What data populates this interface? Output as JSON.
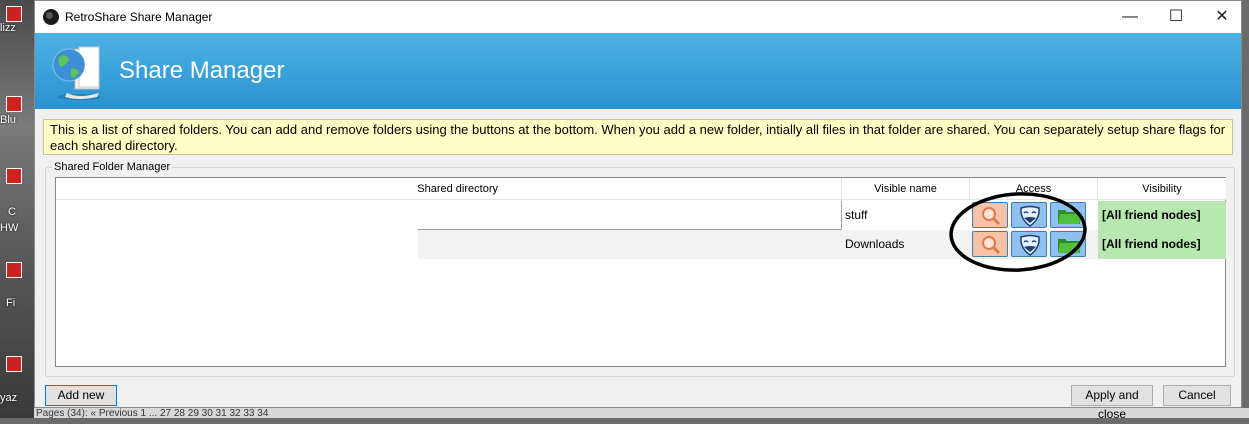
{
  "window": {
    "title": "RetroShare Share Manager",
    "controls": {
      "minimize": "—",
      "maximize": "☐",
      "close": "✕"
    }
  },
  "banner": {
    "title": "Share Manager",
    "icon": "shared-folder-globe-icon"
  },
  "info_text": "This is a list of shared folders. You can add and remove folders using the buttons at the bottom. When you add a new folder, intially all files in that folder are shared. You can separately setup share flags for each shared directory.",
  "group": {
    "legend": "Shared Folder Manager",
    "columns": {
      "shared_directory": "Shared directory",
      "visible_name": "Visible name",
      "access": "Access",
      "visibility": "Visibility"
    },
    "rows": [
      {
        "visible_name": "stuff",
        "access_icons": [
          "search-icon",
          "anonymous-mask-icon",
          "folder-icon"
        ],
        "visibility": "[All friend nodes]"
      },
      {
        "visible_name": "Downloads",
        "access_icons": [
          "search-icon",
          "anonymous-mask-icon",
          "folder-icon"
        ],
        "visibility": "[All friend nodes]"
      }
    ]
  },
  "buttons": {
    "add_new": "Add new",
    "apply_and_close": "Apply and close",
    "cancel": "Cancel"
  },
  "desktop": {
    "labels": [
      "lizz",
      "Blu",
      "C",
      "HW",
      "Fi",
      "yaz"
    ],
    "taskbar_text": "Pages (34):  « Previous  1 ... 27  28  29  30  31  32  33  34"
  },
  "colors": {
    "banner_top": "#4cb2e6",
    "banner_bottom": "#2b92cf",
    "info_bg": "#ffffc6",
    "visibility_bg": "#b6e8b0",
    "search_btn_bg": "#f6c3a9",
    "access_btn_bg": "#8fc1f0"
  }
}
